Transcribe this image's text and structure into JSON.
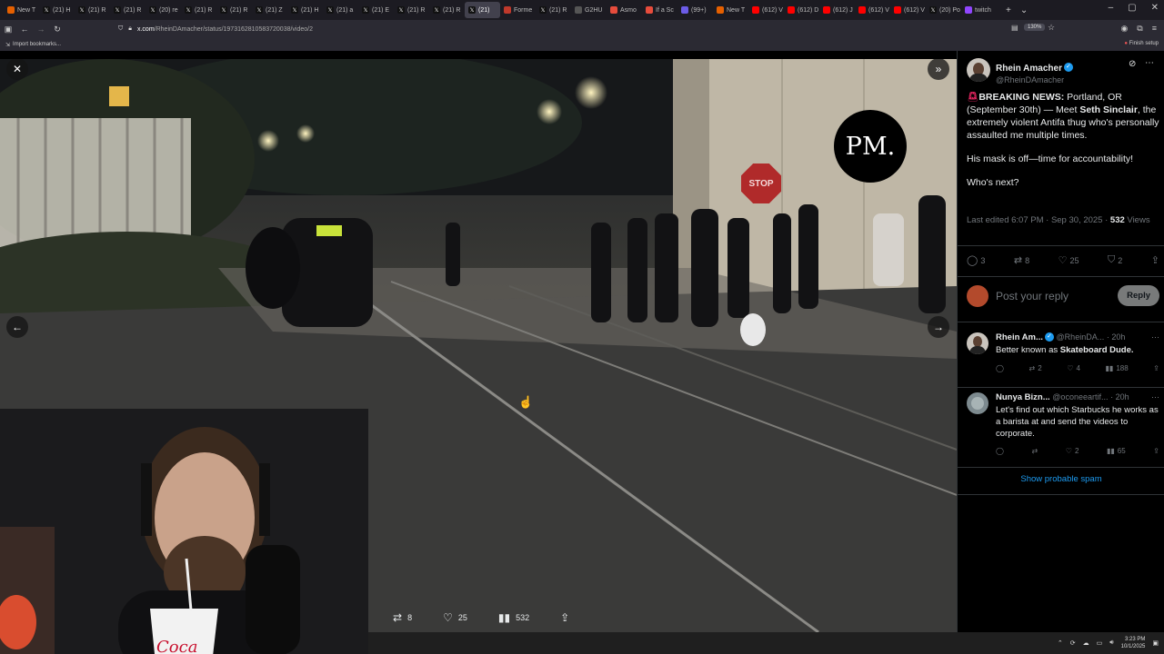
{
  "browser": {
    "tabs": [
      {
        "label": "New T",
        "icon": "firefox-icon",
        "color": "#e66000"
      },
      {
        "label": "(21) H",
        "icon": "x-icon",
        "color": "#111111"
      },
      {
        "label": "(21) R",
        "icon": "x-icon",
        "color": "#111111"
      },
      {
        "label": "(21) R",
        "icon": "x-icon",
        "color": "#111111"
      },
      {
        "label": "(20) re",
        "icon": "x-icon",
        "color": "#111111"
      },
      {
        "label": "(21) R",
        "icon": "x-icon",
        "color": "#111111"
      },
      {
        "label": "(21) R",
        "icon": "x-icon",
        "color": "#111111"
      },
      {
        "label": "(21) Z",
        "icon": "x-icon",
        "color": "#111111"
      },
      {
        "label": "(21) H",
        "icon": "x-icon",
        "color": "#111111"
      },
      {
        "label": "(21) a",
        "icon": "x-icon",
        "color": "#111111"
      },
      {
        "label": "(21) E",
        "icon": "x-icon",
        "color": "#111111"
      },
      {
        "label": "(21) R",
        "icon": "x-icon",
        "color": "#111111"
      },
      {
        "label": "(21) R",
        "icon": "x-icon",
        "color": "#111111"
      },
      {
        "label": "(21)",
        "icon": "x-icon",
        "color": "#111111",
        "active": true
      },
      {
        "label": "Forme",
        "icon": "page-icon",
        "color": "#c0392b"
      },
      {
        "label": "(21) R",
        "icon": "x-icon",
        "color": "#111111"
      },
      {
        "label": "G2HU",
        "icon": "page-icon",
        "color": "#555555"
      },
      {
        "label": "Asmo",
        "icon": "page-icon",
        "color": "#e74c3c"
      },
      {
        "label": "If a Sc",
        "icon": "page-icon",
        "color": "#e74c3c"
      },
      {
        "label": "(99+)",
        "icon": "page-icon",
        "color": "#6c5ce7"
      },
      {
        "label": "New T",
        "icon": "firefox-icon",
        "color": "#e66000"
      },
      {
        "label": "(612) V",
        "icon": "youtube-icon",
        "color": "#ff0000"
      },
      {
        "label": "(612) D",
        "icon": "youtube-icon",
        "color": "#ff0000"
      },
      {
        "label": "(612) J",
        "icon": "youtube-icon",
        "color": "#ff0000"
      },
      {
        "label": "(612) V",
        "icon": "youtube-icon",
        "color": "#ff0000"
      },
      {
        "label": "(612) V",
        "icon": "youtube-icon",
        "color": "#ff0000"
      },
      {
        "label": "(20) Po",
        "icon": "x-icon",
        "color": "#111111"
      },
      {
        "label": "twitch",
        "icon": "twitch-icon",
        "color": "#9146ff"
      }
    ],
    "url_host": "x.com",
    "url_path": "/RheinDAmacher/status/1973162810583720038/video/2",
    "zoom": "130%",
    "bookmarks_label": "Import bookmarks...",
    "finish_setup": "Finish setup"
  },
  "video": {
    "pm_logo": "PM.",
    "stop_sign": "STOP",
    "retweets": "8",
    "likes": "25",
    "views": "532"
  },
  "post": {
    "author_name": "Rhein Amacher",
    "author_handle": "@RheinDAmacher",
    "text_part1": "BREAKING NEWS:",
    "text_part2": " Portland, OR (September 30th) — Meet ",
    "text_part3": "Seth Sinclair",
    "text_part4": ", the extremely violent Antifa thug who's personally assaulted me multiple times.",
    "text_line2": "His mask is off—time for accountability!",
    "text_line3": "Who's next?",
    "meta_prefix": "Last edited 6:07 PM · Sep 30, 2025 · ",
    "meta_views": "532",
    "meta_views_label": " Views",
    "replies": "3",
    "retweets": "8",
    "likes": "25",
    "bookmarks": "2",
    "reply_placeholder": "Post your reply",
    "reply_button": "Reply"
  },
  "comments": [
    {
      "name": "Rhein Am...",
      "handle": "@RheinDA...",
      "time": "· 20h",
      "body_plain": "Better known as ",
      "body_bold": "Skateboard Dude.",
      "retweets": "2",
      "likes": "4",
      "views": "188"
    },
    {
      "name": "Nunya Bizn...",
      "handle": "@oconeeartif...",
      "time": "· 20h",
      "body_plain": "Let's find out which Starbucks he works as a barista at and send the videos to corporate.",
      "body_bold": "",
      "retweets": "",
      "likes": "2",
      "views": "65"
    }
  ],
  "show_spam": "Show probable spam",
  "taskbar": {
    "time": "3:23 PM",
    "date": "10/1/2025"
  }
}
